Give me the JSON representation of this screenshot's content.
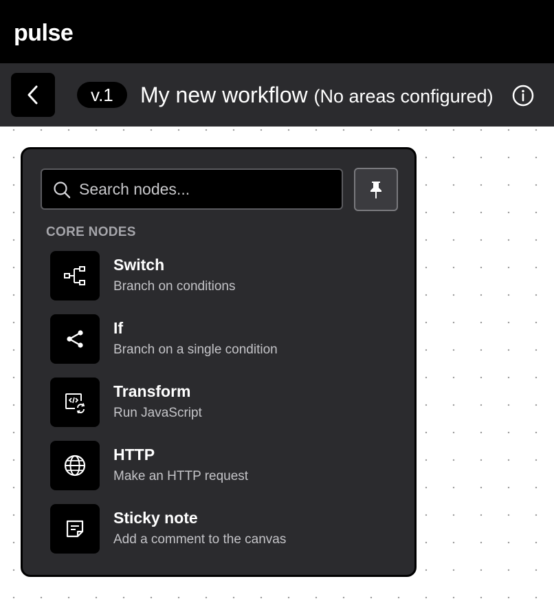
{
  "app": {
    "logo": "pulse"
  },
  "header": {
    "back_icon": "chevron-left-icon",
    "version": "v.1",
    "workflow_name": "My new workflow",
    "workflow_note": "(No areas configured)",
    "info_icon": "info-circle-icon"
  },
  "node_picker": {
    "search": {
      "placeholder": "Search nodes...",
      "value": "",
      "icon": "search-icon"
    },
    "pin_icon": "pin-icon",
    "section_label": "CORE NODES",
    "nodes": [
      {
        "title": "Switch",
        "description": "Branch on conditions",
        "icon": "switch-branch-icon"
      },
      {
        "title": "If",
        "description": "Branch on a single condition",
        "icon": "share-branch-icon"
      },
      {
        "title": "Transform",
        "description": "Run JavaScript",
        "icon": "code-transform-icon"
      },
      {
        "title": "HTTP",
        "description": "Make an HTTP request",
        "icon": "globe-icon"
      },
      {
        "title": "Sticky note",
        "description": "Add a comment to the canvas",
        "icon": "sticky-note-icon"
      }
    ]
  }
}
